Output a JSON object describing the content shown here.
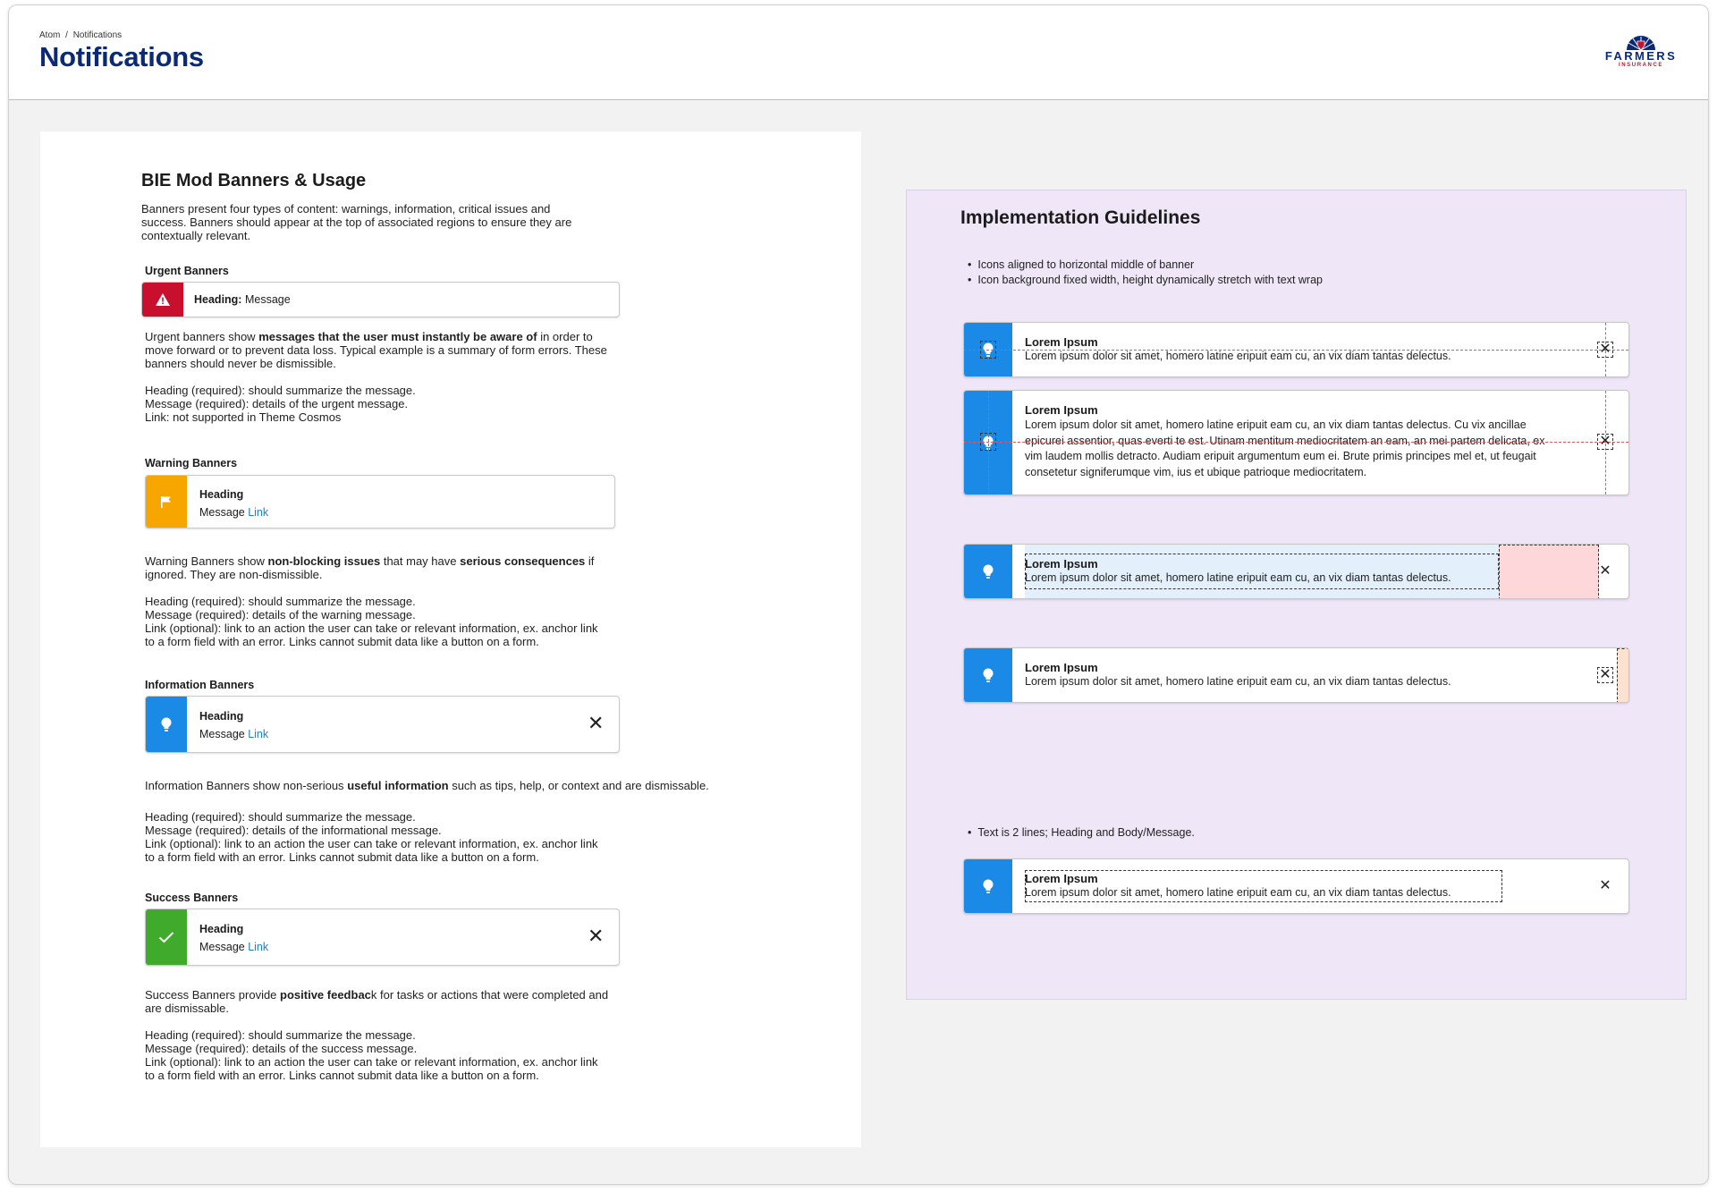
{
  "header": {
    "breadcrumb": [
      "Atom",
      "/",
      "Notifications"
    ],
    "title": "Notifications",
    "logo": {
      "brand": "FARMERS",
      "sub": "INSURANCE"
    }
  },
  "left": {
    "title": "BIE Mod Banners & Usage",
    "intro": [
      "Banners present four types of content: warnings, information, critical issues and",
      "success. Banners should appear at the top of associated regions to ensure they are",
      "contextually relevant."
    ],
    "urgent": {
      "label": "Urgent Banners",
      "banner_heading": "Heading:",
      "banner_message": " Message",
      "desc_a": "Urgent banners show ",
      "desc_b": "messages that the user must instantly be aware of",
      "desc_c": " in order to",
      "desc_lines": [
        "move forward or to prevent data loss. Typical example is a summary of form errors. These",
        "banners should never be dismissible."
      ],
      "rules": [
        "Heading (required): should summarize the message.",
        "Message (required): details of the urgent message.",
        "Link: not supported in Theme Cosmos"
      ]
    },
    "warning": {
      "label": "Warning Banners",
      "banner_heading": "Heading",
      "banner_message": "Message ",
      "banner_link": "Link",
      "desc_a": "Warning Banners show ",
      "desc_b": "non-blocking issues",
      "desc_c": " that may have ",
      "desc_d": "serious consequences",
      "desc_e": " if",
      "desc_line2": "ignored. They are non-dismissible.",
      "rules": [
        "Heading (required): should summarize the message.",
        "Message (required): details of the warning message.",
        "Link (optional): link to an action the user can take or relevant information, ex. anchor link",
        "to a form field with an error. Links cannot submit data like a button on a form."
      ]
    },
    "information": {
      "label": "Information Banners",
      "banner_heading": "Heading",
      "banner_message": "Message ",
      "banner_link": "Link",
      "desc_a": "Information Banners show non-serious ",
      "desc_b": "useful information",
      "desc_c": " such as tips, help, or context and are dismissable.",
      "rules": [
        "Heading (required): should summarize the message.",
        "Message (required): details of the informational message.",
        "Link (optional): link to an action the user can take or relevant information, ex. anchor link",
        "to a form field with an error. Links cannot submit data like a button on a form."
      ]
    },
    "success": {
      "label": "Success Banners",
      "banner_heading": "Heading",
      "banner_message": "Message ",
      "banner_link": "Link",
      "desc_a": "Success Banners provide ",
      "desc_b": "positive feedbac",
      "desc_c": "k for tasks or actions that were completed and",
      "desc_line2": "are dismissable.",
      "rules": [
        "Heading (required): should summarize the message.",
        "Message (required): details of the success message.",
        "Link (optional): link to an action the user can take or relevant information, ex. anchor link",
        "to a form field with an error. Links cannot submit data like a button on a form."
      ]
    }
  },
  "right": {
    "title": "Implementation Guidelines",
    "bullets": [
      "Icons aligned to horizontal middle of banner",
      "Icon background fixed width, height dynamically stretch with text wrap"
    ],
    "bullet2": "Text is 2 lines; Heading and Body/Message.",
    "banner_heading": "Lorem Ipsum",
    "banner_message": "Lorem ipsum dolor sit amet, homero latine eripuit eam cu, an vix diam tantas delectus.",
    "long_message": [
      "Lorem ipsum dolor sit amet, homero latine eripuit eam cu, an vix diam tantas delectus. Cu vix ancillae",
      "epicurei assentior, quas everti te est. Utinam mentitum mediocritatem an eam, an mei partem delicata, ex",
      "vim laudem mollis detracto. Audiam eripuit argumentum eum ei. Brute primis principes mel et, ut feugait",
      "consetetur signiferumque vim, ius et ubique patrioque mediocritatem."
    ]
  },
  "colors": {
    "urgent": "#c8102e",
    "warning": "#f7a600",
    "information": "#1a8ae6",
    "success": "#3faa2c",
    "title_blue": "#0b2a75",
    "link": "#1a7fd4",
    "guide_bg": "#efe6f8"
  },
  "icons": [
    "warning-triangle-icon",
    "flag-icon",
    "lightbulb-icon",
    "checkmark-icon",
    "close-icon"
  ]
}
